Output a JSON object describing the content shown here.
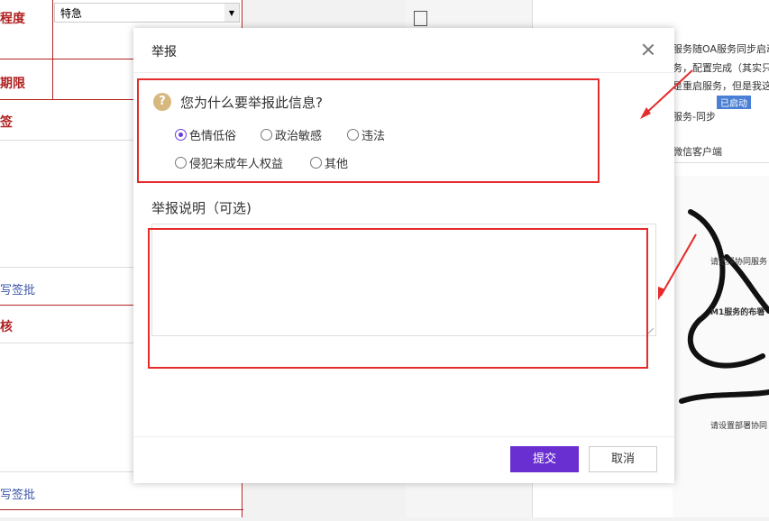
{
  "background": {
    "form_labels": [
      "程度",
      "期限",
      "签",
      "核"
    ],
    "urgency_value": "特急",
    "sign_links": [
      "写签批",
      "写签批"
    ],
    "right_lines": [
      "服务随OA服务同步启动",
      "务，配置完成（其实只",
      "是重启服务，但是我这",
      "已启动",
      "服务-同步",
      "微信客户端",
      "请选择协同服务",
      "M1服务的布署",
      "请设置部署协同"
    ]
  },
  "dialog": {
    "title": "举报",
    "question": "您为什么要举报此信息?",
    "question_icon": "?",
    "options": [
      {
        "label": "色情低俗",
        "checked": true
      },
      {
        "label": "政治敏感",
        "checked": false
      },
      {
        "label": "违法",
        "checked": false
      },
      {
        "label": "侵犯未成年人权益",
        "checked": false
      },
      {
        "label": "其他",
        "checked": false
      }
    ],
    "description_label": "举报说明（可选)",
    "description_value": "",
    "submit_label": "提交",
    "cancel_label": "取消"
  },
  "colors": {
    "accent": "#6a2fd1",
    "annotation": "#e52b2b",
    "form_red": "#b22222",
    "icon_gold": "#d7b97f"
  }
}
